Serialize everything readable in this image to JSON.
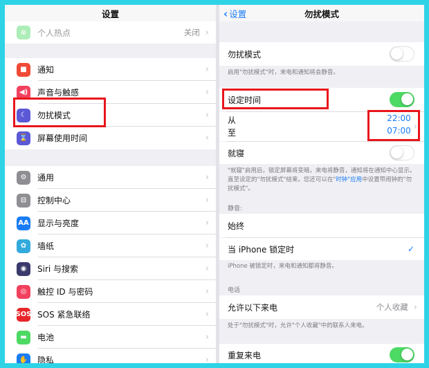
{
  "left": {
    "title": "设置",
    "hotspot": {
      "label": "个人热点",
      "value": "关闭"
    },
    "group1": [
      {
        "label": "通知",
        "icon": "notifications-icon",
        "color": "#f04a37",
        "glyph": "■"
      },
      {
        "label": "声音与触感",
        "icon": "sound-icon",
        "color": "#f2415e",
        "glyph": "◀)"
      },
      {
        "label": "勿扰模式",
        "icon": "moon-icon",
        "color": "#5b59d6",
        "glyph": "☾"
      },
      {
        "label": "屏幕使用时间",
        "icon": "hourglass-icon",
        "color": "#5b59d6",
        "glyph": "⌛"
      }
    ],
    "group2": [
      {
        "label": "通用",
        "icon": "gear-icon",
        "color": "#8e8e93",
        "glyph": "⚙"
      },
      {
        "label": "控制中心",
        "icon": "switches-icon",
        "color": "#8e8e93",
        "glyph": "⊟"
      },
      {
        "label": "显示与亮度",
        "icon": "brightness-icon",
        "color": "#1a7cf5",
        "glyph": "AA"
      },
      {
        "label": "墙纸",
        "icon": "flower-icon",
        "color": "#33aadc",
        "glyph": "✿"
      },
      {
        "label": "Siri 与搜索",
        "icon": "siri-icon",
        "color": "#3a3a6c",
        "glyph": "◉"
      },
      {
        "label": "触控 ID 与密码",
        "icon": "fingerprint-icon",
        "color": "#f2415e",
        "glyph": "◎"
      },
      {
        "label": "SOS 紧急联络",
        "icon": "sos-icon",
        "color": "#e8262a",
        "glyph": "SOS"
      },
      {
        "label": "电池",
        "icon": "battery-icon",
        "color": "#4cd964",
        "glyph": "▬"
      },
      {
        "label": "隐私",
        "icon": "hand-icon",
        "color": "#1a7cf5",
        "glyph": "✋"
      }
    ]
  },
  "right": {
    "back": "设置",
    "title": "勿扰模式",
    "dnd_label": "勿扰模式",
    "dnd_note": "启用\"勿扰模式\"时，来电和通知将会静音。",
    "scheduled_label": "设定时间",
    "from_label": "从",
    "to_label": "至",
    "from_time": "22:00",
    "to_time": "07:00",
    "bedtime_label": "就寝",
    "bedtime_note_1": "\"就寝\"启用后，锁定屏幕将变暗，来电将静音，通知将在通知中心显示。直至设定的\"勿扰模式\"结束。您还可以在\"",
    "bedtime_note_link": "时钟\"应用",
    "bedtime_note_2": "中设置带闹钟的\"勿扰模式\"。",
    "silence_head": "静音:",
    "always_label": "始终",
    "locked_label": "当 iPhone 锁定时",
    "locked_note": "iPhone 被锁定时，来电和通知都将静音。",
    "phone_head": "电话",
    "allow_calls_label": "允许以下来电",
    "allow_calls_value": "个人收藏",
    "allow_calls_note": "处于\"勿扰模式\"时，允许\"个人收藏\"中的联系人来电。",
    "repeated_label": "重复来电"
  },
  "colors": {
    "accent": "#1a7cf5",
    "toggle_on": "#4cd964",
    "highlight": "#e8151b"
  }
}
